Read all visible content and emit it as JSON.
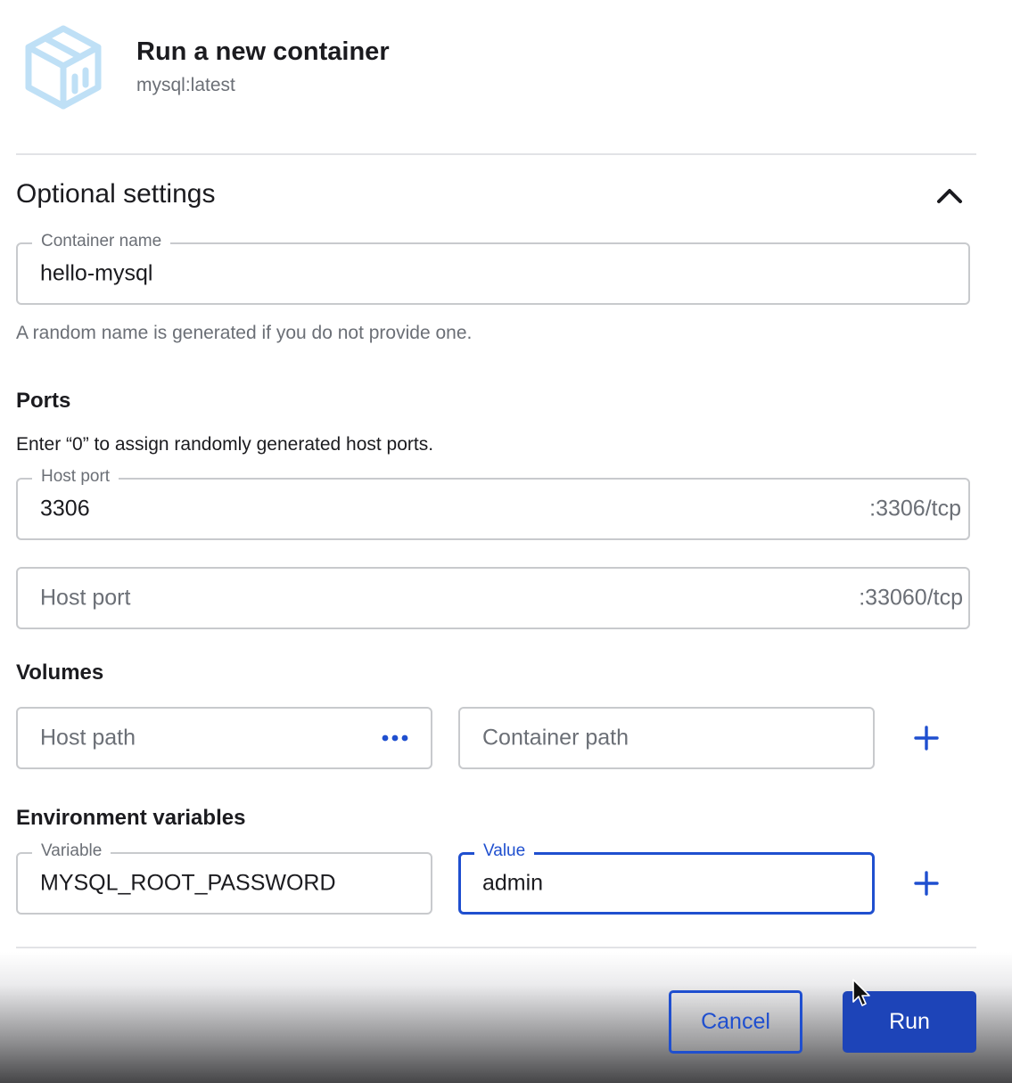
{
  "header": {
    "icon": "container-box-icon",
    "title": "Run a new container",
    "subtitle": "mysql:latest"
  },
  "optional_settings": {
    "title": "Optional settings",
    "toggle_icon": "chevron-up-icon",
    "container_name": {
      "label": "Container name",
      "value": "hello-mysql",
      "helper": "A random name is generated if you do not provide one."
    }
  },
  "ports": {
    "title": "Ports",
    "description": "Enter “0” to assign randomly generated host ports.",
    "items": [
      {
        "label": "Host port",
        "value": "3306",
        "suffix": ":3306/tcp"
      },
      {
        "placeholder": "Host port",
        "suffix": ":33060/tcp"
      }
    ]
  },
  "volumes": {
    "title": "Volumes",
    "host_path_placeholder": "Host path",
    "browse_icon": "more-horizontal-icon",
    "container_path_placeholder": "Container path",
    "add_icon": "plus-icon"
  },
  "environment": {
    "title": "Environment variables",
    "variable_label": "Variable",
    "variable_value": "MYSQL_ROOT_PASSWORD",
    "value_label": "Value",
    "value_value": "admin",
    "add_icon": "plus-icon"
  },
  "footer": {
    "cancel_label": "Cancel",
    "run_label": "Run"
  },
  "colors": {
    "accent": "#1f4fcf",
    "run_button": "#1d44b8",
    "icon_light": "#bfe0f6",
    "border": "#c8cacd",
    "muted_text": "#6b6f76"
  }
}
